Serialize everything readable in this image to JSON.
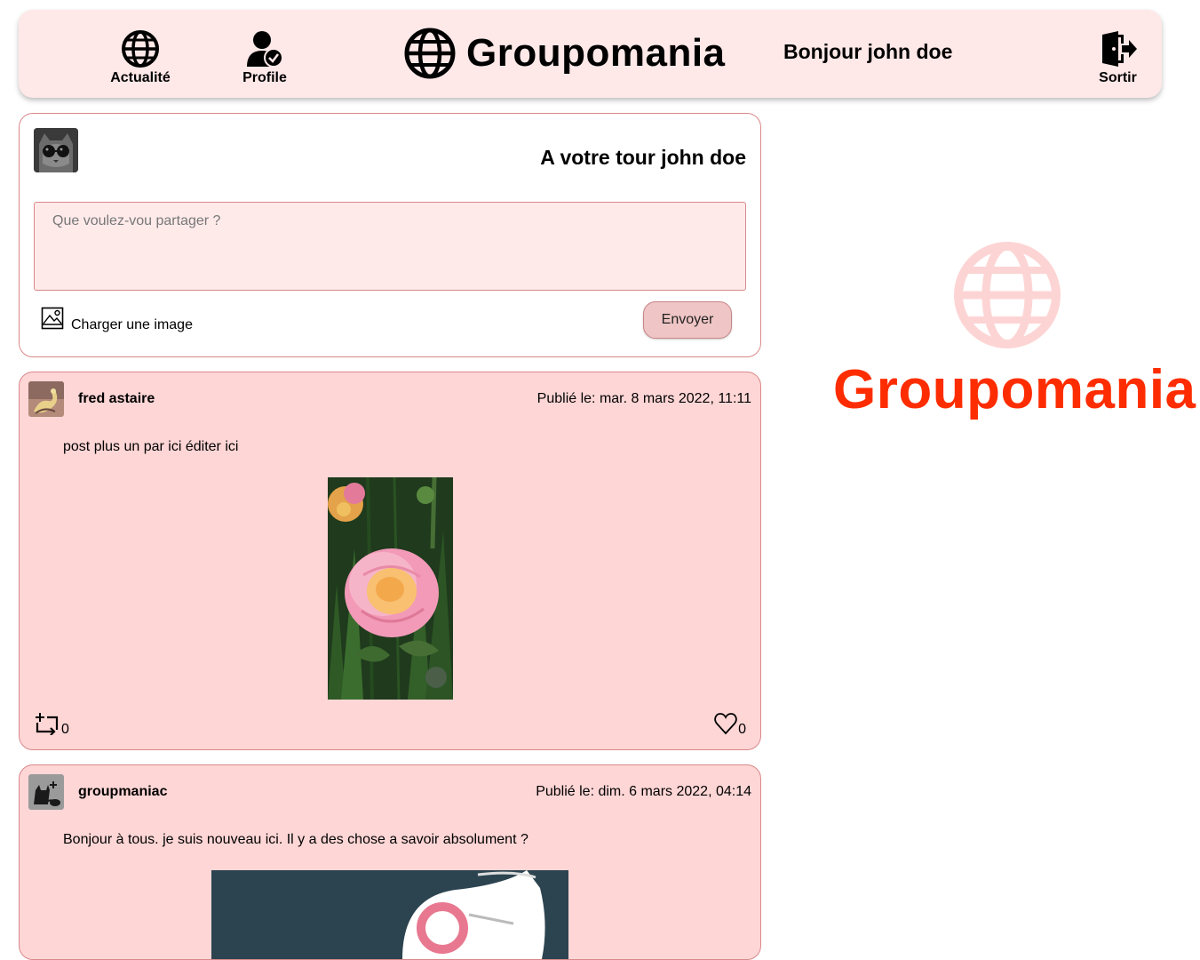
{
  "header": {
    "nav": [
      {
        "label": "Actualité",
        "icon": "globe-icon"
      },
      {
        "label": "Profile",
        "icon": "user-check-icon"
      }
    ],
    "brand": {
      "title": "Groupomania",
      "icon": "globe-icon"
    },
    "greeting": "Bonjour john doe",
    "logout": {
      "label": "Sortir",
      "icon": "door-exit-icon"
    }
  },
  "composer": {
    "heading": "A votre tour john doe",
    "placeholder": "Que voulez-vou partager ?",
    "upload_label": "Charger une image",
    "send_label": "Envoyer"
  },
  "posts": [
    {
      "author": "fred astaire",
      "date": "Publié le: mar. 8 mars 2022, 11:11",
      "text": "post plus un par ici éditer ici",
      "likes": "0",
      "shares": "0"
    },
    {
      "author": "groupmaniac",
      "date": "Publié le: dim. 6 mars 2022, 04:14",
      "text": "Bonjour à tous. je suis nouveau ici. Il y a des chose a savoir absolument ?"
    }
  ],
  "side_logo": {
    "title": "Groupomania",
    "color": "#fd2d01",
    "icon_color": "#fdd4d4"
  },
  "colors": {
    "header_bg": "#ffe8e8",
    "post_bg": "#ffd6d6",
    "border": "#d9888a",
    "button_bg": "#efc5c5"
  }
}
